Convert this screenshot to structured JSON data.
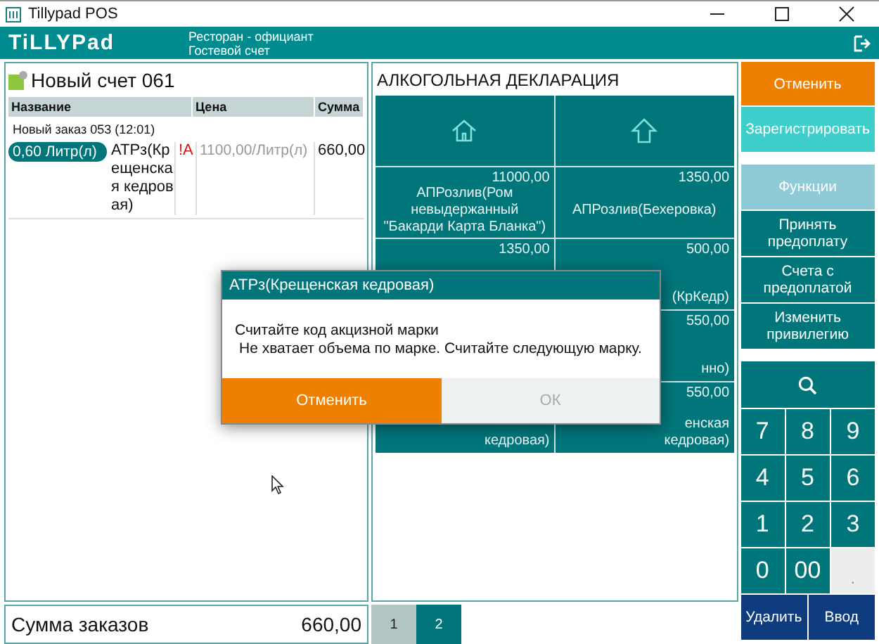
{
  "window": {
    "title": "Tillypad POS"
  },
  "header": {
    "logo": "TiLLYPad",
    "lines": [
      "Ресторан - официант",
      "Гостевой счет"
    ]
  },
  "bill": {
    "title": "Новый счет 061",
    "columns": [
      "Название",
      "Цена",
      "Сумма"
    ],
    "order_label": "Новый заказ 053 (12:01)",
    "items": [
      {
        "qty": "0,60 Литр(л)",
        "name": "АТРз(Крещенская кедровая)",
        "flag": "!A",
        "price": "1100,00/Литр(л)",
        "sum": "660,00"
      }
    ]
  },
  "total": {
    "label": "Сумма заказов",
    "value": "660,00"
  },
  "declaration": {
    "title": "АЛКОГОЛЬНАЯ ДЕКЛАРАЦИЯ",
    "nav": [
      {
        "kind": "home"
      },
      {
        "kind": "up"
      }
    ],
    "tile_rows": [
      {
        "tiles": [
          {
            "kind": "full",
            "price": "11000,00",
            "name": "АПРозлив(Ром невыдержанный \"Бакарди Карта Бланка\")"
          },
          {
            "kind": "full",
            "price": "1350,00",
            "name": "АПРозлив(Бехеровка)"
          }
        ]
      },
      {
        "tiles": [
          {
            "kind": "cut",
            "price": "1350,00"
          },
          {
            "kind": "cut",
            "price": "500,00",
            "name": "(КрКедр)"
          }
        ]
      },
      {
        "tiles": [
          {
            "kind": "hidden"
          },
          {
            "kind": "cut",
            "price": "550,00",
            "name": "нно)"
          }
        ]
      },
      {
        "tiles": [
          {
            "kind": "cut",
            "name": "кедровая)"
          },
          {
            "kind": "cut",
            "price": "550,00",
            "name": "енская кедровая)"
          }
        ]
      }
    ]
  },
  "pages": [
    {
      "label": "1",
      "selected": true
    },
    {
      "label": "2",
      "selected": false
    }
  ],
  "actions": [
    {
      "label": "Отменить",
      "kind": "cancel"
    },
    {
      "label": "Зарегистрировать",
      "kind": "register"
    },
    {
      "label": "Функции",
      "kind": "functions"
    },
    {
      "label": "Принять предоплату",
      "kind": "normal"
    },
    {
      "label": "Счета с предоплатой",
      "kind": "normal"
    },
    {
      "label": "Изменить привилегию",
      "kind": "normal"
    }
  ],
  "keys": [
    {
      "label": "7",
      "disabled": false
    },
    {
      "label": "8",
      "disabled": false
    },
    {
      "label": "9",
      "disabled": false
    },
    {
      "label": "4",
      "disabled": false
    },
    {
      "label": "5",
      "disabled": false
    },
    {
      "label": "6",
      "disabled": false
    },
    {
      "label": "1",
      "disabled": false
    },
    {
      "label": "2",
      "disabled": false
    },
    {
      "label": "3",
      "disabled": false
    },
    {
      "label": "0",
      "disabled": false
    },
    {
      "label": "00",
      "disabled": false
    },
    {
      "label": ".",
      "disabled": true
    }
  ],
  "bottom_buttons": [
    "Удалить",
    "Ввод"
  ],
  "dialog": {
    "title": "АТРз(Крещенская кедровая)",
    "lines": [
      "Считайте код акцизной марки",
      "Не хватает объема по марке. Считайте следующую марку."
    ],
    "buttons": [
      {
        "label": "Отменить",
        "kind": "primary"
      },
      {
        "label": "ОК",
        "kind": "disabled"
      }
    ]
  }
}
